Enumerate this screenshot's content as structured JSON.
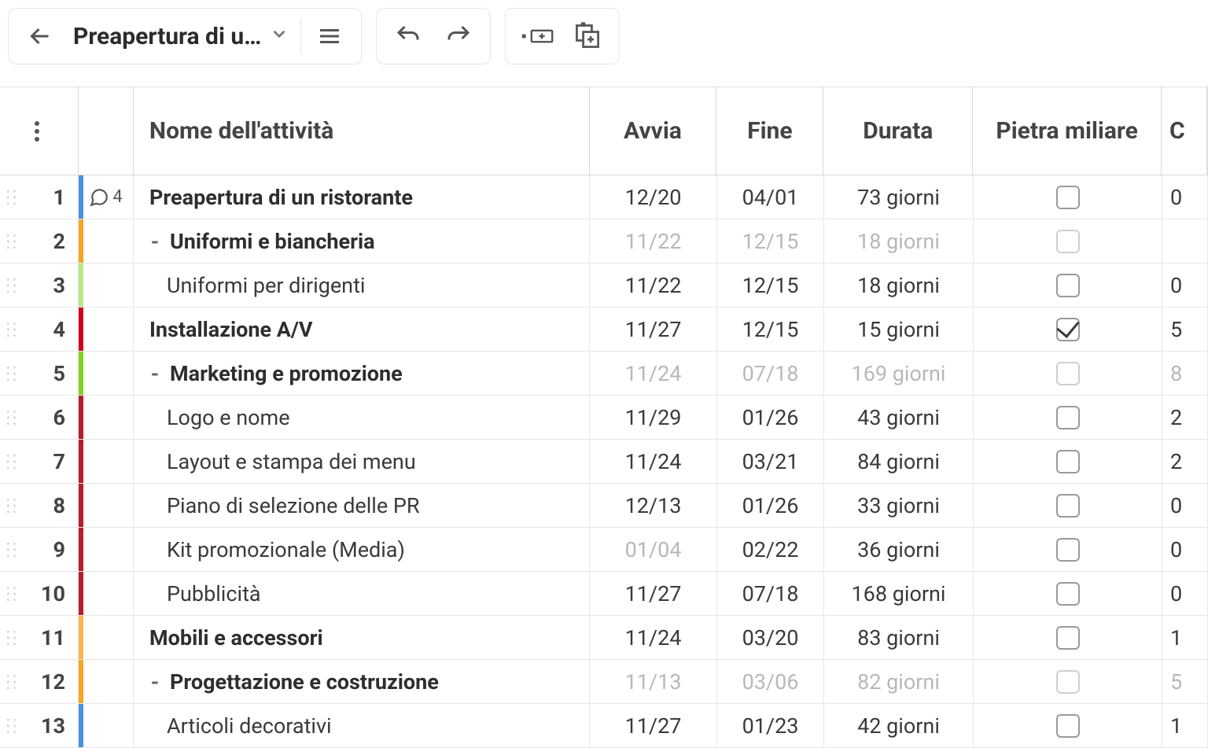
{
  "toolbar": {
    "title": "Preapertura di u…"
  },
  "columns": {
    "name": "Nome dell'attività",
    "start": "Avvia",
    "end": "Fine",
    "duration": "Durata",
    "milestone": "Pietra miliare",
    "c": "C"
  },
  "rows": [
    {
      "num": "1",
      "color": "#4a90e2",
      "comment_count": "4",
      "indent": 0,
      "collapsible": false,
      "bold": true,
      "muted": false,
      "name": "Preapertura di un ristorante",
      "start": "12/20",
      "end": "04/01",
      "duration": "73 giorni",
      "milestone": false,
      "c": "0"
    },
    {
      "num": "2",
      "color": "#f5a623",
      "comment_count": "",
      "indent": 0,
      "collapsible": true,
      "bold": true,
      "muted": true,
      "name": "Uniformi e biancheria",
      "start": "11/22",
      "end": "12/15",
      "duration": "18 giorni",
      "milestone": false,
      "c": ""
    },
    {
      "num": "3",
      "color": "#b8e986",
      "comment_count": "",
      "indent": 2,
      "collapsible": false,
      "bold": false,
      "muted": false,
      "name": "Uniformi per dirigenti",
      "start": "11/22",
      "end": "12/15",
      "duration": "18 giorni",
      "milestone": false,
      "c": "0"
    },
    {
      "num": "4",
      "color": "#d0021b",
      "comment_count": "",
      "indent": 0,
      "collapsible": false,
      "bold": true,
      "muted": false,
      "name": "Installazione A/V",
      "start": "11/27",
      "end": "12/15",
      "duration": "15 giorni",
      "milestone": true,
      "c": "5"
    },
    {
      "num": "5",
      "color": "#7ed321",
      "comment_count": "",
      "indent": 0,
      "collapsible": true,
      "bold": true,
      "muted": true,
      "name": "Marketing e promozione",
      "start": "11/24",
      "end": "07/18",
      "duration": "169 giorni",
      "milestone": false,
      "c": "8"
    },
    {
      "num": "6",
      "color": "#b51d2a",
      "comment_count": "",
      "indent": 2,
      "collapsible": false,
      "bold": false,
      "muted": false,
      "name": "Logo e nome",
      "start": "11/29",
      "end": "01/26",
      "duration": "43 giorni",
      "milestone": false,
      "c": "2"
    },
    {
      "num": "7",
      "color": "#b51d2a",
      "comment_count": "",
      "indent": 2,
      "collapsible": false,
      "bold": false,
      "muted": false,
      "name": "Layout e stampa dei menu",
      "start": "11/24",
      "end": "03/21",
      "duration": "84 giorni",
      "milestone": false,
      "c": "2"
    },
    {
      "num": "8",
      "color": "#b51d2a",
      "comment_count": "",
      "indent": 2,
      "collapsible": false,
      "bold": false,
      "muted": false,
      "name": "Piano di selezione delle PR",
      "start": "12/13",
      "end": "01/26",
      "duration": "33 giorni",
      "milestone": false,
      "c": "0"
    },
    {
      "num": "9",
      "color": "#b51d2a",
      "comment_count": "",
      "indent": 2,
      "collapsible": false,
      "bold": false,
      "muted": false,
      "name": "Kit promozionale (Media)",
      "start": "01/04",
      "end": "02/22",
      "duration": "36 giorni",
      "milestone": false,
      "c": "0",
      "start_muted": true
    },
    {
      "num": "10",
      "color": "#b51d2a",
      "comment_count": "",
      "indent": 2,
      "collapsible": false,
      "bold": false,
      "muted": false,
      "name": "Pubblicità",
      "start": "11/27",
      "end": "07/18",
      "duration": "168 giorni",
      "milestone": false,
      "c": "0"
    },
    {
      "num": "11",
      "color": "#f8b84e",
      "comment_count": "",
      "indent": 0,
      "collapsible": false,
      "bold": true,
      "muted": false,
      "name": "Mobili e accessori",
      "start": "11/24",
      "end": "03/20",
      "duration": "83 giorni",
      "milestone": false,
      "c": "1"
    },
    {
      "num": "12",
      "color": "#f5a623",
      "comment_count": "",
      "indent": 0,
      "collapsible": true,
      "bold": true,
      "muted": true,
      "name": "Progettazione e costruzione",
      "start": "11/13",
      "end": "03/06",
      "duration": "82 giorni",
      "milestone": false,
      "c": "5"
    },
    {
      "num": "13",
      "color": "#4a90e2",
      "comment_count": "",
      "indent": 2,
      "collapsible": false,
      "bold": false,
      "muted": false,
      "name": "Articoli decorativi",
      "start": "11/27",
      "end": "01/23",
      "duration": "42 giorni",
      "milestone": false,
      "c": "1"
    }
  ]
}
